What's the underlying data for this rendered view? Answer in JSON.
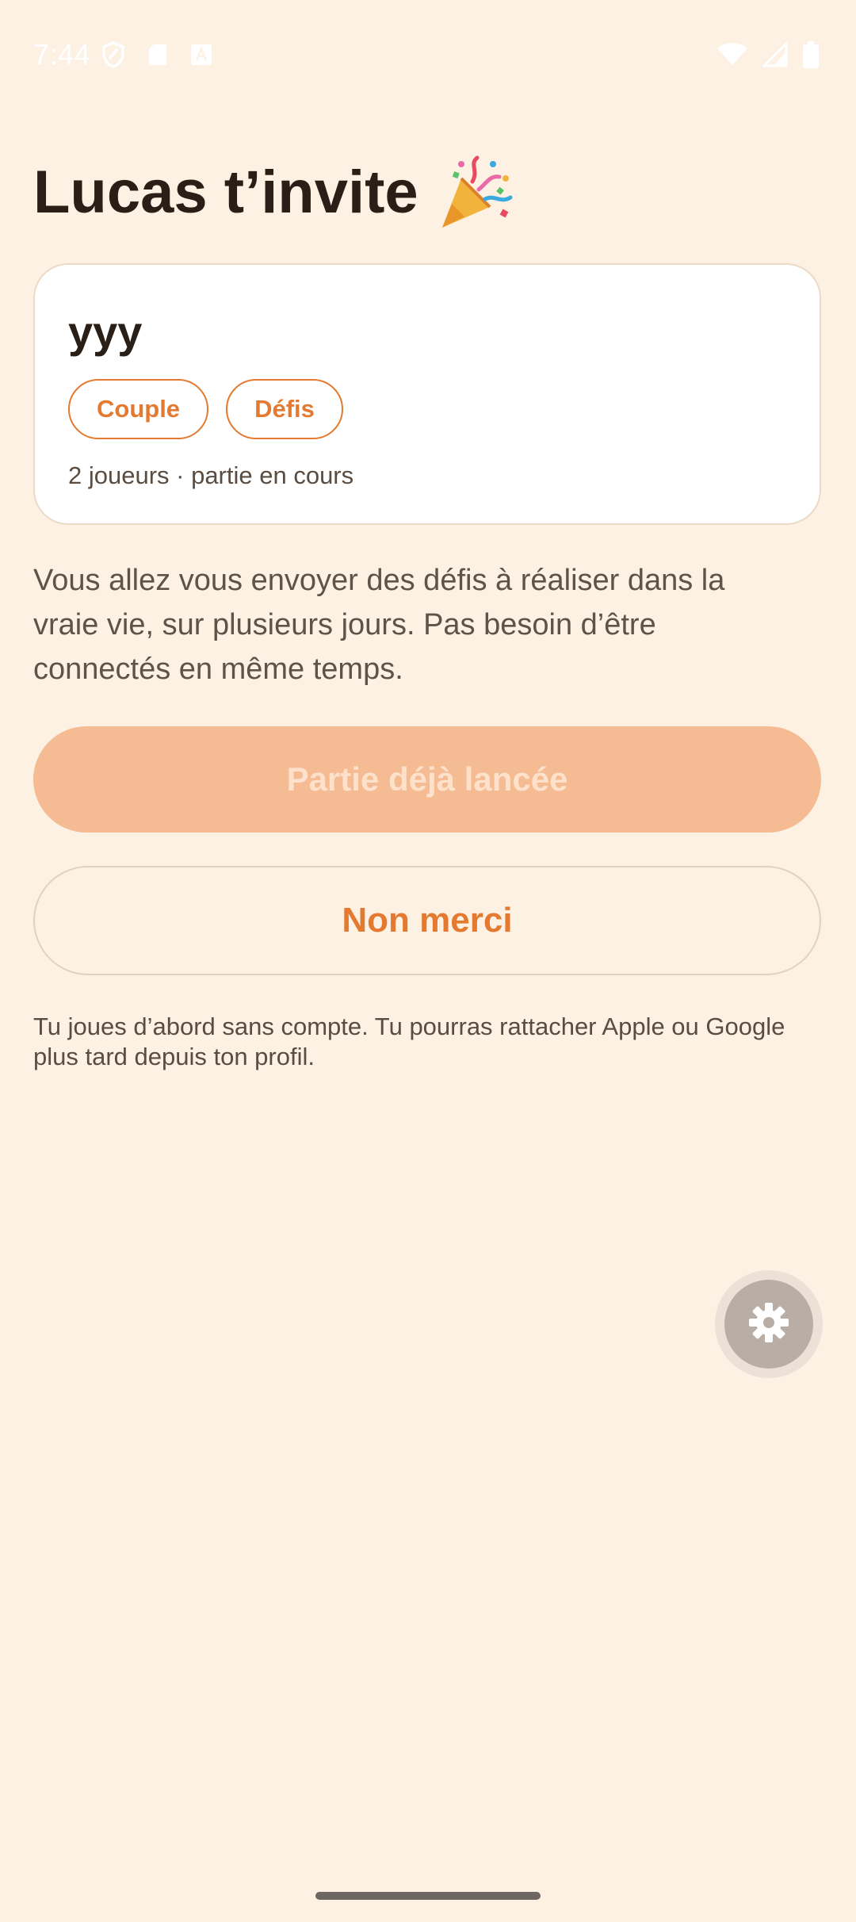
{
  "status_bar": {
    "time": "7:44",
    "icons": [
      "shield-icon",
      "sim-card-icon",
      "text-a-icon",
      "wifi-icon",
      "signal-icon",
      "battery-icon"
    ]
  },
  "header": {
    "title": "Lucas t’invite",
    "emoji_icon": "party-popper-icon"
  },
  "game_card": {
    "name": "yyy",
    "tags": [
      "Couple",
      "Défis"
    ],
    "meta": "2 joueurs · partie en cours"
  },
  "description": "Vous allez vous envoyer des défis à réaliser dans la vraie vie, sur plusieurs jours. Pas besoin d’être connectés en même temps.",
  "actions": {
    "primary_label": "Partie déjà lancée",
    "secondary_label": "Non merci"
  },
  "footnote": "Tu joues d’abord sans compte. Tu pourras rattacher Apple ou Google plus tard depuis ton profil.",
  "fab": {
    "icon": "gear-icon"
  },
  "colors": {
    "background": "#fdf1e4",
    "accent": "#e37a30",
    "primary_disabled": "#f5bb93",
    "card": "#ffffff",
    "text": "#2a1f16",
    "muted_text": "#5f5246"
  }
}
